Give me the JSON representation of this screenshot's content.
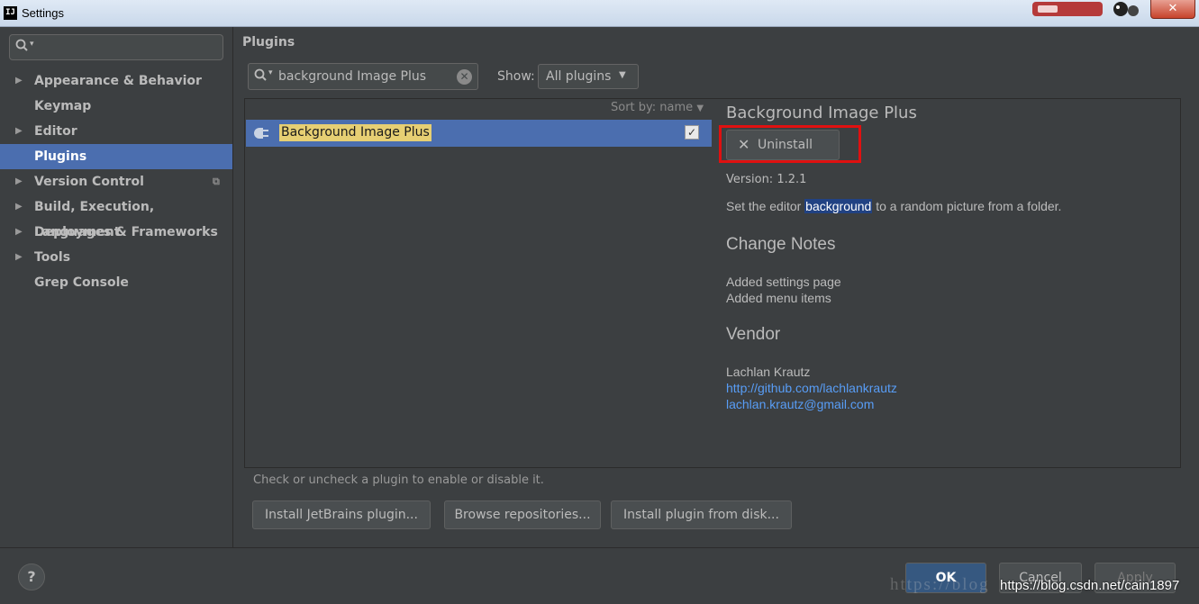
{
  "window": {
    "title": "Settings",
    "app_icon": "IJ",
    "close_glyph": "✕"
  },
  "sidebar": {
    "search_icon": "search-icon",
    "items": [
      {
        "label": "Appearance & Behavior",
        "expandable": true,
        "selected": false
      },
      {
        "label": "Keymap",
        "expandable": false,
        "selected": false
      },
      {
        "label": "Editor",
        "expandable": true,
        "selected": false
      },
      {
        "label": "Plugins",
        "expandable": false,
        "selected": true
      },
      {
        "label": "Version Control",
        "expandable": true,
        "selected": false
      },
      {
        "label": "Build, Execution, Deployment",
        "expandable": true,
        "selected": false
      },
      {
        "label": "Languages & Frameworks",
        "expandable": true,
        "selected": false
      },
      {
        "label": "Tools",
        "expandable": true,
        "selected": false
      },
      {
        "label": "Grep Console",
        "expandable": false,
        "selected": false
      }
    ]
  },
  "plugins": {
    "title": "Plugins",
    "search_value": "background Image Plus",
    "show_label": "Show:",
    "show_value": "All plugins",
    "sort_label": "Sort by: name",
    "list": [
      {
        "name": "Background Image Plus",
        "enabled": true
      }
    ],
    "hint": "Check or uncheck a plugin to enable or disable it.",
    "buttons": {
      "install_jetbrains": "Install JetBrains plugin...",
      "browse": "Browse repositories...",
      "install_disk": "Install plugin from disk..."
    }
  },
  "details": {
    "name": "Background Image Plus",
    "uninstall_label": "Uninstall",
    "version": "Version: 1.2.1",
    "desc_before": "Set the editor ",
    "desc_highlight": "background",
    "desc_after": " to a random picture from a folder.",
    "change_notes_title": "Change Notes",
    "change_notes": [
      "Added settings page",
      "Added menu items"
    ],
    "vendor_title": "Vendor",
    "vendor_name": "Lachlan Krautz",
    "vendor_url": "http://github.com/lachlankrautz",
    "vendor_email": "lachlan.krautz@gmail.com"
  },
  "dialog": {
    "help": "?",
    "ok": "OK",
    "cancel": "Cancel",
    "apply": "Apply"
  },
  "watermark": {
    "faint": "https://blog",
    "text": "https://blog.csdn.net/cain1897"
  },
  "colors": {
    "selection": "#4b6eaf",
    "search_highlight": "#e6cf73",
    "link": "#589df6",
    "annotation": "#e01010"
  }
}
